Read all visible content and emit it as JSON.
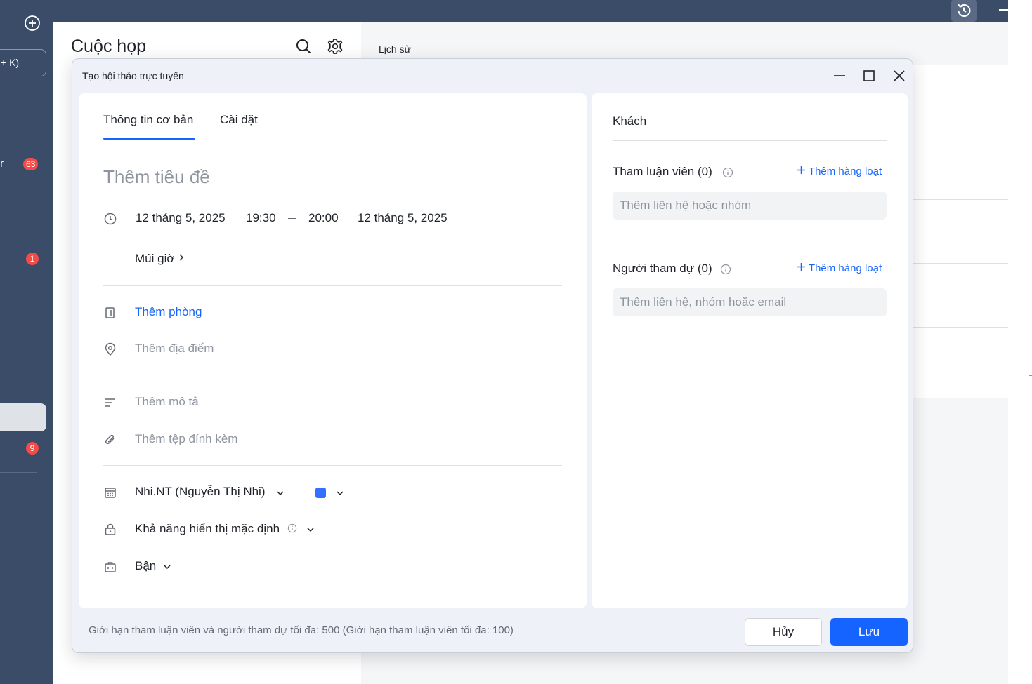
{
  "app": {
    "page_title": "Cuộc họp",
    "history_label": "Lịch sử",
    "shortcut_fragment": "+ K)",
    "rail_letter": "r",
    "badges": [
      "63",
      "1",
      "9"
    ]
  },
  "dialog": {
    "title": "Tạo hội thảo trực tuyến",
    "tabs": [
      {
        "label": "Thông tin cơ bản",
        "active": true
      },
      {
        "label": "Cài đặt",
        "active": false
      }
    ],
    "title_placeholder": "Thêm tiêu đề",
    "start_date": "12 tháng 5, 2025",
    "start_time": "19:30",
    "end_time": "20:00",
    "end_date": "12 tháng 5, 2025",
    "timezone_label": "Múi giờ",
    "add_room": "Thêm phòng",
    "add_location": "Thêm địa điểm",
    "add_description": "Thêm mô tả",
    "add_attachment": "Thêm tệp đính kèm",
    "calendar_owner": "Nhi.NT (Nguyễn Thị Nhi)",
    "calendar_color": "#3370ff",
    "visibility": "Khả năng hiển thị mặc định",
    "availability": "Bận",
    "guests": {
      "heading": "Khách",
      "panelists_label": "Tham luận viên (0)",
      "panelists_bulk": "Thêm hàng loạt",
      "panelists_placeholder": "Thêm liên hệ hoặc nhóm",
      "attendees_label": "Người tham dự (0)",
      "attendees_bulk": "Thêm hàng loạt",
      "attendees_placeholder": "Thêm liên hệ, nhóm hoặc email"
    },
    "footer_note": "Giới hạn tham luận viên và người tham dự tối đa: 500 (Giới hạn tham luận viên tối đa: 100)",
    "cancel_label": "Hủy",
    "save_label": "Lưu"
  },
  "colors": {
    "accent": "#1664ff",
    "rail": "#3b4c68",
    "badge": "#f54a45"
  }
}
